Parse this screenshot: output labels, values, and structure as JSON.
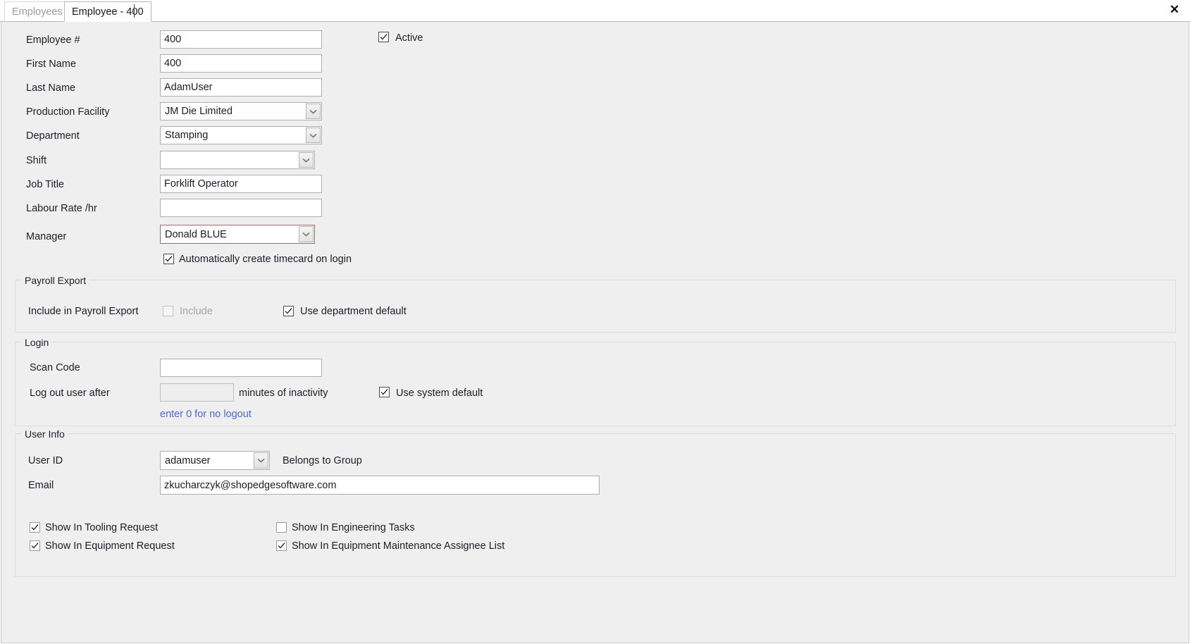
{
  "window": {
    "close_label": "✕"
  },
  "tabs": [
    {
      "label": "Employees",
      "active": false
    },
    {
      "label": "Employee - 400",
      "active": true
    }
  ],
  "form": {
    "fields": {
      "employee_number": {
        "label": "Employee #",
        "value": "400"
      },
      "first_name": {
        "label": "First Name",
        "value": "400"
      },
      "last_name": {
        "label": "Last Name",
        "value": "AdamUser"
      },
      "production_facility": {
        "label": "Production Facility",
        "value": "JM Die Limited"
      },
      "department": {
        "label": "Department",
        "value": "Stamping"
      },
      "shift": {
        "label": "Shift",
        "value": ""
      },
      "job_title": {
        "label": "Job Title",
        "value": "Forklift Operator"
      },
      "labour_rate": {
        "label": "Labour Rate /hr",
        "value": ""
      },
      "manager": {
        "label": "Manager",
        "value": "Donald BLUE"
      }
    },
    "active_checkbox": {
      "label": "Active",
      "checked": true
    },
    "auto_timecard_checkbox": {
      "label": "Automatically create timecard on login",
      "checked": true
    }
  },
  "payroll_export": {
    "legend": "Payroll Export",
    "include_label": "Include in Payroll Export",
    "include_checkbox": {
      "label": "Include",
      "checked": false,
      "disabled": true
    },
    "use_department_default": {
      "label": "Use department  default",
      "checked": true
    }
  },
  "login": {
    "legend": "Login",
    "scan_code": {
      "label": "Scan Code",
      "value": ""
    },
    "logout_after": {
      "label": "Log out user after",
      "value": "",
      "disabled": true
    },
    "minutes_suffix": "minutes of inactivity",
    "use_system_default": {
      "label": "Use system default",
      "checked": true
    },
    "hint": "enter 0 for no logout"
  },
  "user_info": {
    "legend": "User Info",
    "user_id": {
      "label": "User ID",
      "value": "adamuser"
    },
    "belongs_to_group": "Belongs to Group",
    "email": {
      "label": "Email",
      "value": "zkucharczyk@shopedgesoftware.com"
    },
    "checkboxes": [
      {
        "label": "Show In Tooling Request",
        "checked": true
      },
      {
        "label": "Show In Equipment Request",
        "checked": true
      },
      {
        "label": "Show In Engineering Tasks",
        "checked": false
      },
      {
        "label": "Show In Equipment Maintenance Assignee List",
        "checked": true
      }
    ]
  },
  "colors": {
    "background": "#efefef",
    "text": "#1d1d28",
    "hint_blue": "#4d68d6",
    "disabled_text": "#a6a6a6",
    "border": "#aeaeae"
  }
}
